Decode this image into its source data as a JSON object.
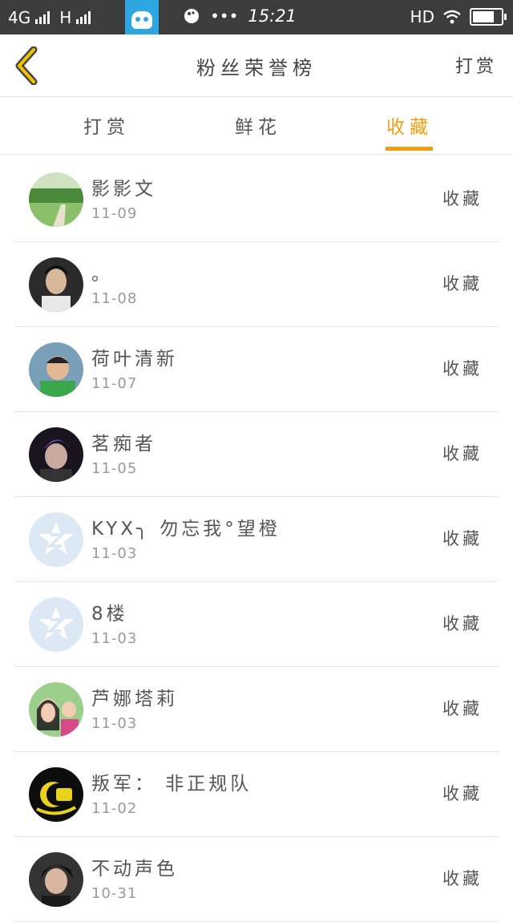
{
  "status_bar": {
    "network": "4G",
    "network2": "H",
    "time": "15:21",
    "hd": "HD",
    "dots": "•••"
  },
  "header": {
    "title": "粉丝荣誉榜",
    "right_action": "打赏",
    "back_icon": "chevron-left-icon",
    "accent_color": "#f39c12"
  },
  "tabs": [
    {
      "label": "打赏",
      "active": false
    },
    {
      "label": "鲜花",
      "active": false
    },
    {
      "label": "收藏",
      "active": true
    }
  ],
  "fans": [
    {
      "name": "影影文",
      "date": "11-09",
      "action": "收藏",
      "avatar": "landscape-avatar"
    },
    {
      "name": "。",
      "date": "11-08",
      "action": "收藏",
      "avatar": "man-avatar"
    },
    {
      "name": "荷叶清新",
      "date": "11-07",
      "action": "收藏",
      "avatar": "child-avatar"
    },
    {
      "name": "茗痴者",
      "date": "11-05",
      "action": "收藏",
      "avatar": "dark-avatar"
    },
    {
      "name": "KYX╮ 勿忘我°望橙",
      "date": "11-03",
      "action": "收藏",
      "avatar": "default-qq-avatar"
    },
    {
      "name": "8楼",
      "date": "11-03",
      "action": "收藏",
      "avatar": "default-qq-avatar"
    },
    {
      "name": "芦娜塔莉",
      "date": "11-03",
      "action": "收藏",
      "avatar": "girl-avatar"
    },
    {
      "name": "叛军： 非正规队",
      "date": "11-02",
      "action": "收藏",
      "avatar": "yellow-logo-avatar"
    },
    {
      "name": "不动声色",
      "date": "10-31",
      "action": "收藏",
      "avatar": "boy-avatar"
    }
  ]
}
